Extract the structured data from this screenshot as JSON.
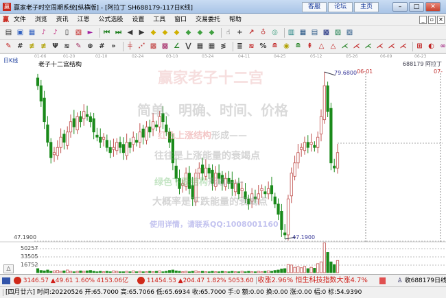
{
  "window": {
    "title": "赢家老子时空周期系统[纵横版] - [阿拉丁  SH688179-117日K线]",
    "logo": "赢",
    "links": [
      "客服",
      "论坛",
      "主页"
    ],
    "controls": [
      "–",
      "□",
      "✕"
    ]
  },
  "menu": {
    "items": [
      "文件",
      "浏览",
      "资讯",
      "江恩",
      "公式选股",
      "设置",
      "工具",
      "窗口",
      "交易委托",
      "帮助"
    ],
    "mdi": [
      "_",
      "▫",
      "✕"
    ]
  },
  "chart": {
    "period_label": "日K线",
    "indicator_name": "老子十二宫结构",
    "stock_label": "688179 阿拉丁",
    "dates": [
      "01-06",
      "01-20",
      "02-10",
      "02-24",
      "03-10",
      "03-24",
      "04-11",
      "04-25",
      "05-12",
      "05-26",
      "06-09",
      "06-23"
    ],
    "high_marker": "79.6800",
    "low_marker": "47.1900",
    "low_axis_label": "47.1900",
    "future_date_label": "06-01",
    "future_date_label2": "07-",
    "watermark": {
      "title": "赢家老子十二宫",
      "line1": "简单、明确、时间、价格",
      "line2a": "红色上涨结构",
      "line2b": "形成——",
      "line3": "往往是上涨能量的衰竭点",
      "line4a": "绿色下跌结构",
      "line4b": "形成——",
      "line5": "大概率是下跌能量的衰竭点",
      "contact": "使用详情，请联系QQ:1008001160"
    },
    "volume_labels": [
      "50257",
      "33505",
      "16752"
    ],
    "collapse_button": "△"
  },
  "chart_data": {
    "type": "candlestick",
    "price_range": [
      47.19,
      79.68
    ],
    "closes": [
      77,
      74,
      70,
      66,
      63,
      64,
      65,
      67,
      66,
      68,
      70,
      69,
      71,
      70,
      72,
      71,
      70,
      68,
      67,
      66,
      67,
      65,
      64,
      65,
      66,
      65,
      64,
      66,
      65,
      67,
      66,
      68,
      67,
      69,
      68,
      70,
      69,
      71,
      70,
      68,
      66,
      62,
      59,
      57,
      58,
      60,
      57,
      55,
      60,
      61,
      60,
      61,
      60,
      58,
      60,
      59,
      58,
      59,
      58,
      57,
      58,
      56,
      57,
      55,
      54,
      56,
      55,
      56,
      57,
      56,
      57,
      56,
      54,
      52,
      49,
      48,
      55,
      60,
      62,
      64,
      65,
      66,
      65,
      66,
      65,
      67,
      71,
      77,
      72,
      62,
      61,
      64
    ],
    "high_index": 87,
    "high_value": 79.68,
    "low_index": 75,
    "low_value": 47.19,
    "volume_max": 67000,
    "volumes": [
      9000,
      5000,
      4000,
      6000,
      3000,
      4000,
      5000,
      3000,
      4000,
      6000,
      3000,
      2000,
      3000,
      4000,
      3000,
      4000,
      5000,
      3000,
      2000,
      3000,
      2000,
      3000,
      2000,
      4000,
      3000,
      2000,
      2000,
      3000,
      2000,
      4000,
      2000,
      3000,
      2000,
      2000,
      3000,
      2000,
      3000,
      4000,
      2000,
      3000,
      5000,
      6000,
      4000,
      3000,
      2000,
      3000,
      2000,
      3000,
      4000,
      2000,
      3000,
      2000,
      2000,
      3000,
      2000,
      2000,
      3000,
      2000,
      2000,
      3000,
      2000,
      2000,
      3000,
      2000,
      3000,
      2000,
      2000,
      3000,
      2000,
      3000,
      4000,
      3000,
      5000,
      6000,
      8000,
      9000,
      18000,
      17000,
      12000,
      13000,
      11000,
      14000,
      9000,
      12000,
      10000,
      20000,
      24000,
      66000,
      45000,
      24000,
      18000,
      27000
    ]
  },
  "status1": {
    "sh_index": "3146.57",
    "sh_change": "▲49.61",
    "sh_pct": "1.60%",
    "sh_amount": "4153.06亿",
    "hk_index": "11454.53",
    "hk_change": "▲204.47",
    "hk_pct": "1.82%",
    "hk_amount": "5053.60",
    "news": "收涨2.96% 恒生科技指数大涨4.7%",
    "right_label": "收688179日线"
  },
  "status2": {
    "text": "[四月廿六] 时间:20220526 开:65.7000 高:65.7066 低:65.6934 收:65.7000 手:0 额:0.00 换:0.00 涨:0.00 幅:0 标:54.9390"
  },
  "colors": {
    "up": "#c0504d",
    "down": "#1a8a1a",
    "accent": "#d0201a"
  }
}
